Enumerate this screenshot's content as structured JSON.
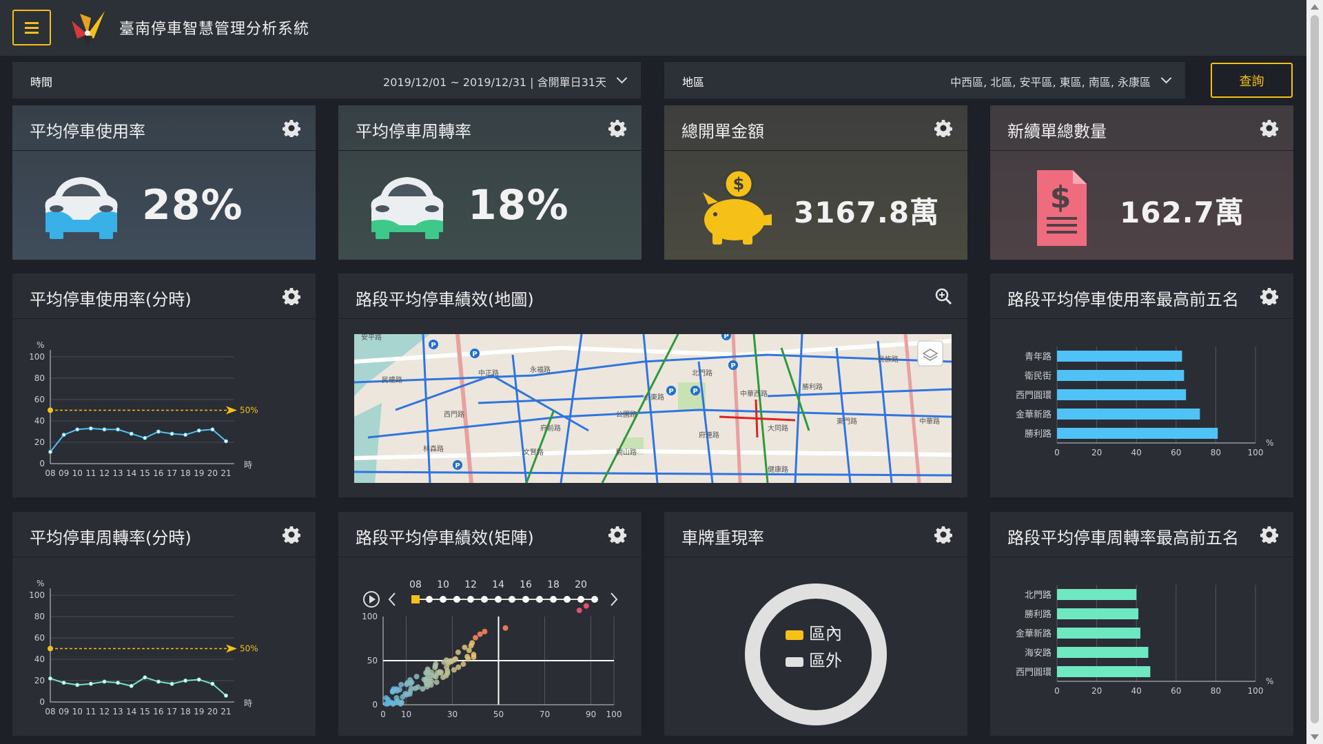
{
  "app": {
    "title": "臺南停車智慧管理分析系統"
  },
  "filters": {
    "time_label": "時間",
    "time_value": "2019/12/01 ~ 2019/12/31 | 含開單日31天",
    "area_label": "地區",
    "area_value": "中西區, 北區, 安平區, 東區, 南區, 永康區",
    "query_button": "查詢"
  },
  "kpis": [
    {
      "title": "平均停車使用率",
      "value": "28%",
      "icon": "car-icon",
      "accent": "#3ab0e8"
    },
    {
      "title": "平均停車周轉率",
      "value": "18%",
      "icon": "car-icon",
      "accent": "#3ec98a"
    },
    {
      "title": "總開單金額",
      "value": "3167.8萬",
      "icon": "piggy-bank-icon",
      "accent": "#f5c018"
    },
    {
      "title": "新續單總數量",
      "value": "162.7萬",
      "icon": "invoice-icon",
      "accent": "#ef6b7e"
    }
  ],
  "panels": {
    "usage_hourly_title": "平均停車使用率(分時)",
    "map_title": "路段平均停車績效(地圖)",
    "top5_usage_title": "路段平均停車使用率最高前五名",
    "turnover_hourly_title": "平均停車周轉率(分時)",
    "matrix_title": "路段平均停車績效(矩陣)",
    "plate_title": "車牌重現率",
    "top5_turnover_title": "路段平均停車周轉率最高前五名"
  },
  "chart_data": [
    {
      "type": "line",
      "x": [
        "08",
        "09",
        "10",
        "11",
        "12",
        "13",
        "14",
        "15",
        "16",
        "17",
        "18",
        "19",
        "20",
        "21"
      ],
      "series": [
        {
          "values": [
            11,
            27,
            32,
            33,
            32,
            32,
            28,
            24,
            30,
            28,
            27,
            31,
            32,
            21
          ]
        }
      ],
      "reference_line": {
        "value": 50,
        "label": "50%"
      },
      "ylabel": "%",
      "xlabel": "時",
      "ylim": [
        0,
        100
      ],
      "yticks": [
        0,
        20,
        40,
        60,
        80,
        100
      ],
      "color": "#4fc3f7"
    },
    {
      "type": "bar",
      "orientation": "horizontal",
      "categories": [
        "青年路",
        "衛民街",
        "西門圓環",
        "金華新路",
        "勝利路"
      ],
      "values": [
        63,
        64,
        65,
        72,
        81
      ],
      "xlim": [
        0,
        100
      ],
      "xticks": [
        0,
        20,
        40,
        60,
        80,
        100
      ],
      "xlabel": "%",
      "color": "#4fc3f7"
    },
    {
      "type": "line",
      "x": [
        "08",
        "09",
        "10",
        "11",
        "12",
        "13",
        "14",
        "15",
        "16",
        "17",
        "18",
        "19",
        "20",
        "21"
      ],
      "series": [
        {
          "values": [
            22,
            18,
            16,
            17,
            19,
            18,
            15,
            23,
            19,
            17,
            20,
            21,
            17,
            6
          ]
        }
      ],
      "reference_line": {
        "value": 50,
        "label": "50%"
      },
      "ylabel": "%",
      "xlabel": "時",
      "ylim": [
        0,
        100
      ],
      "yticks": [
        0,
        20,
        40,
        60,
        80,
        100
      ],
      "color": "#6ee8c0"
    },
    {
      "type": "scatter",
      "xticks": [
        0,
        10,
        30,
        50,
        70,
        90,
        100
      ],
      "yticks": [
        0,
        50,
        100
      ],
      "timeline_labels": [
        "08",
        "10",
        "12",
        "14",
        "16",
        "18",
        "20"
      ],
      "timeline_selected": "08",
      "quadrant_lines": {
        "x": 50,
        "y": 50
      },
      "colors": [
        "#5ab4e8",
        "#f5d76e",
        "#e57a5a",
        "#e05070"
      ]
    },
    {
      "type": "pie",
      "labels": [
        "區內",
        "區外"
      ],
      "values": [
        0,
        100
      ],
      "colors": [
        "#f5c018",
        "#e0e0e0"
      ]
    },
    {
      "type": "bar",
      "orientation": "horizontal",
      "categories": [
        "北門路",
        "勝利路",
        "金華新路",
        "海安路",
        "西門圓環"
      ],
      "values": [
        40,
        41,
        42,
        46,
        47
      ],
      "xlim": [
        0,
        100
      ],
      "xticks": [
        0,
        20,
        40,
        60,
        80,
        100
      ],
      "xlabel": "%",
      "color": "#6ee8c0"
    }
  ],
  "map_labels": [
    "安平路",
    "民權路",
    "中正路",
    "永福路",
    "西門路",
    "公園路",
    "北門路",
    "中華路",
    "文賢路",
    "開山路",
    "府前路",
    "大同路",
    "小東路",
    "東門路",
    "健康路",
    "林森路",
    "民族路",
    "勝利路",
    "中華西路",
    "府連路"
  ]
}
